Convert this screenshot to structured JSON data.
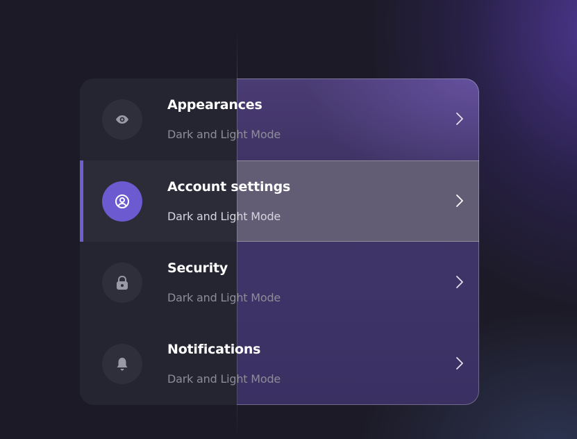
{
  "colors": {
    "accent": "#6c5ad0",
    "background": "#1c1a26",
    "panel": "#252431",
    "title_text": "#ffffff",
    "subtitle_text": "#8e8c9a"
  },
  "menu": {
    "items": [
      {
        "title": "Appearances",
        "subtitle": "Dark and Light Mode",
        "icon": "eye-icon",
        "active": false
      },
      {
        "title": "Account settings",
        "subtitle": "Dark and Light Mode",
        "icon": "user-circle-icon",
        "active": true
      },
      {
        "title": "Security",
        "subtitle": "Dark and Light Mode",
        "icon": "lock-icon",
        "active": false
      },
      {
        "title": "Notifications",
        "subtitle": "Dark and Light Mode",
        "icon": "bell-icon",
        "active": false
      }
    ]
  }
}
